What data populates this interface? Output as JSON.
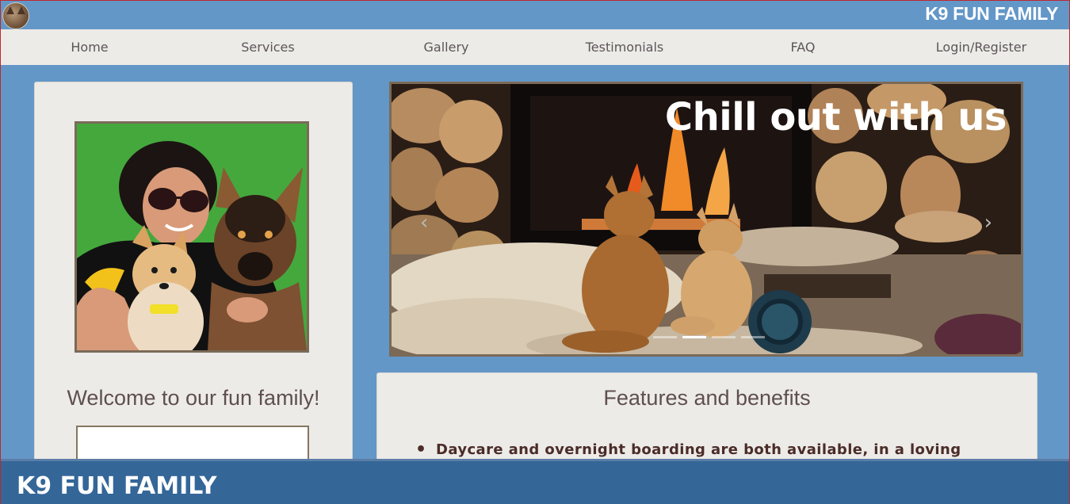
{
  "header": {
    "brand": "K9 FUN FAMILY",
    "logo_icon": "dog-logo-icon"
  },
  "nav": {
    "items": [
      {
        "label": "Home"
      },
      {
        "label": "Services"
      },
      {
        "label": "Gallery"
      },
      {
        "label": "Testimonials"
      },
      {
        "label": "FAQ"
      },
      {
        "label": "Login/Register"
      }
    ]
  },
  "welcome": {
    "title": "Welcome to our fun family!"
  },
  "carousel": {
    "caption": "Chill out with us",
    "prev_icon": "chevron-left-icon",
    "next_icon": "chevron-right-icon",
    "slide_count": 4,
    "active_index": 1
  },
  "features": {
    "title": "Features and benefits",
    "bullets": [
      "Daycare and overnight boarding are both available, in a loving home"
    ]
  },
  "footer": {
    "brand": "K9 FUN FAMILY"
  },
  "colors": {
    "page_bg": "#6397c8",
    "nav_bg": "#edebe8",
    "footer_bg": "#346698",
    "heading_text": "#5e4f4f"
  }
}
